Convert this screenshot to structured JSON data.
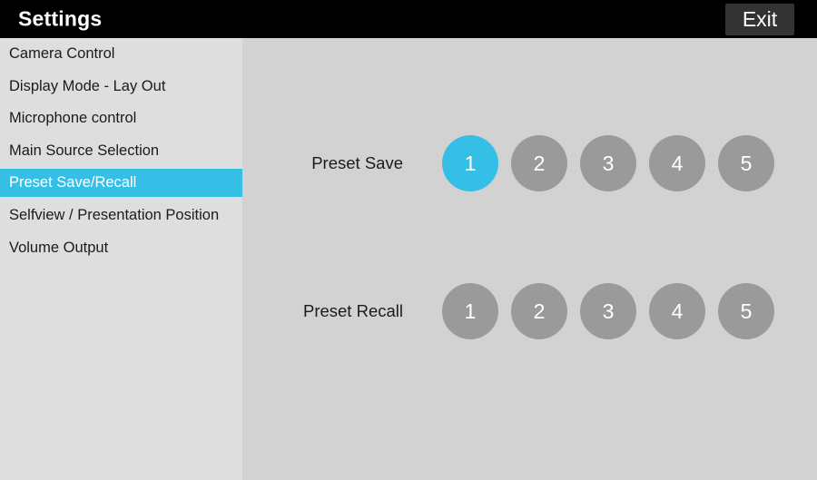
{
  "titlebar": {
    "title": "Settings",
    "exit_label": "Exit"
  },
  "sidebar": {
    "items": [
      {
        "label": "Camera Control",
        "selected": false
      },
      {
        "label": "Display Mode - Lay Out",
        "selected": false
      },
      {
        "label": "Microphone control",
        "selected": false
      },
      {
        "label": "Main Source Selection",
        "selected": false
      },
      {
        "label": "Preset Save/Recall",
        "selected": true
      },
      {
        "label": "Selfview / Presentation Position",
        "selected": false
      },
      {
        "label": "Volume Output",
        "selected": false
      }
    ]
  },
  "main": {
    "rows": [
      {
        "label": "Preset Save",
        "buttons": [
          {
            "label": "1",
            "active": true
          },
          {
            "label": "2",
            "active": false
          },
          {
            "label": "3",
            "active": false
          },
          {
            "label": "4",
            "active": false
          },
          {
            "label": "5",
            "active": false
          }
        ]
      },
      {
        "label": "Preset Recall",
        "buttons": [
          {
            "label": "1",
            "active": false
          },
          {
            "label": "2",
            "active": false
          },
          {
            "label": "3",
            "active": false
          },
          {
            "label": "4",
            "active": false
          },
          {
            "label": "5",
            "active": false
          }
        ]
      }
    ]
  },
  "colors": {
    "accent": "#35bfe6",
    "button_inactive": "#9a9a9a",
    "titlebar_bg": "#000000",
    "sidebar_bg": "#dedede",
    "content_bg": "#d2d2d2",
    "exit_bg": "#333333"
  }
}
